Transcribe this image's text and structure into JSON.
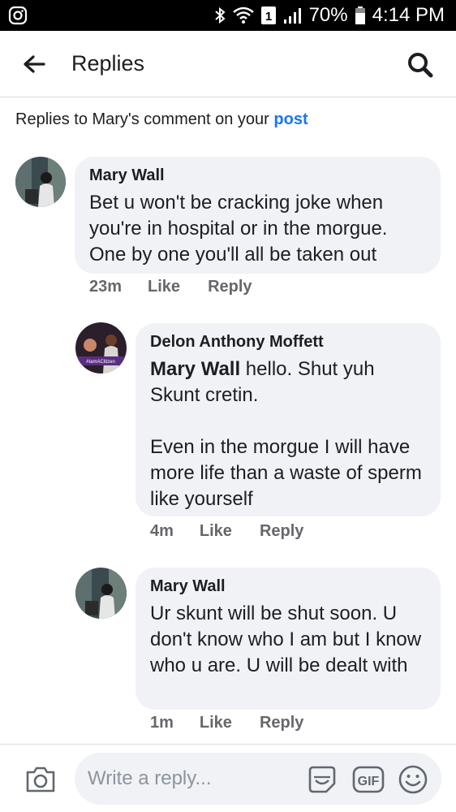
{
  "status_bar": {
    "battery": "70%",
    "time": "4:14 PM",
    "sim_slot": "1"
  },
  "header": {
    "title": "Replies"
  },
  "context": {
    "text": "Replies to Mary's comment on your ",
    "link": "post"
  },
  "comments": [
    {
      "author": "Mary Wall",
      "text": "Bet u won't be cracking joke when you're in hospital or in the morgue. One by one you'll all be taken out",
      "time": "23m",
      "like": "Like",
      "reply": "Reply"
    },
    {
      "author": "Delon Anthony Moffett",
      "mention": "Mary Wall",
      "text": " hello. Shut yuh Skunt cretin.\n\nEven in the morgue I will have more life than a waste of sperm like yourself",
      "time": "4m",
      "like": "Like",
      "reply": "Reply",
      "avatar_badge": "#IamACitizen"
    },
    {
      "author": "Mary Wall",
      "text": "Ur skunt will be shut soon. U don't know who I am but I know who u are. U will be dealt with",
      "time": "1m",
      "like": "Like",
      "reply": "Reply"
    }
  ],
  "composer": {
    "placeholder": "Write a reply...",
    "gif_label": "GIF"
  },
  "colors": {
    "link": "#1877f2",
    "bubble": "#f0f2f5",
    "meta": "#65676b"
  }
}
